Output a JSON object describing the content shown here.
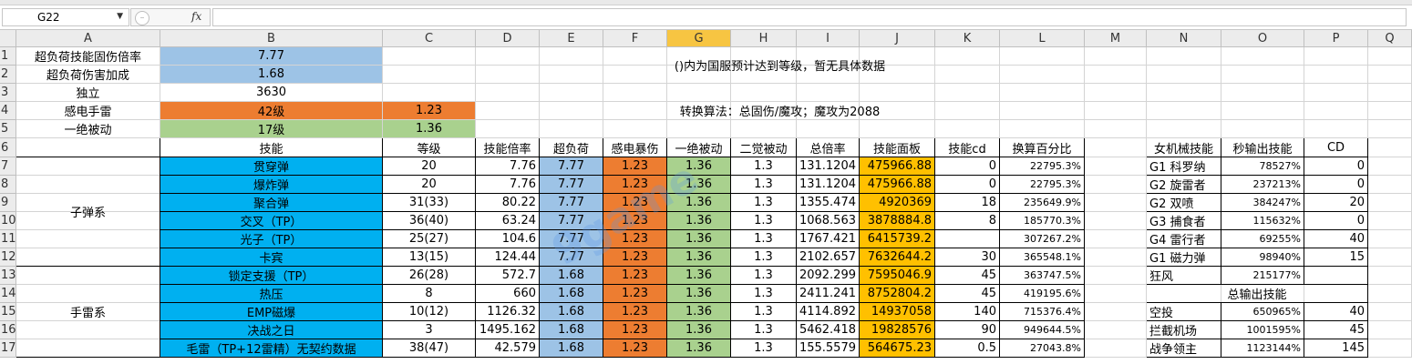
{
  "app": {
    "name_box": "G22",
    "formula_value": ""
  },
  "columns": [
    "A",
    "B",
    "C",
    "D",
    "E",
    "F",
    "G",
    "H",
    "I",
    "J",
    "K",
    "L",
    "M",
    "N",
    "O",
    "P",
    "Q"
  ],
  "selected_column": "G",
  "row_headers": [
    "1",
    "2",
    "3",
    "4",
    "5",
    "6",
    "7",
    "8",
    "9",
    "10",
    "11",
    "12",
    "13",
    "14",
    "15",
    "16",
    "17"
  ],
  "params": [
    {
      "label": "超负荷技能固伤倍率",
      "value": "7.77",
      "extra": ""
    },
    {
      "label": "超负荷伤害加成",
      "value": "1.68",
      "extra": ""
    },
    {
      "label": "独立",
      "value": "3630",
      "extra": ""
    },
    {
      "label": "感电手雷",
      "value": "42级",
      "extra": "1.23"
    },
    {
      "label": "一绝被动",
      "value": "17级",
      "extra": "1.36"
    }
  ],
  "notes": {
    "note1": "()内为国服预计达到等级，暂无具体数据",
    "note2": "转换算法：总固伤/魔攻；魔攻为2088"
  },
  "table": {
    "headers": [
      "技能",
      "等级",
      "技能倍率",
      "超负荷",
      "感电暴伤",
      "一绝被动",
      "二觉被动",
      "总倍率",
      "技能面板",
      "技能cd",
      "换算百分比"
    ],
    "groups": [
      {
        "name": "子弹系",
        "rows": 6
      },
      {
        "name": "手雷系",
        "rows": 5
      }
    ],
    "rows": [
      [
        "贯穿弹",
        "20",
        "7.76",
        "7.77",
        "1.23",
        "1.36",
        "1.3",
        "131.1204",
        "475966.88",
        "0",
        "22795.3%"
      ],
      [
        "爆炸弹",
        "20",
        "7.76",
        "7.77",
        "1.23",
        "1.36",
        "1.3",
        "131.1204",
        "475966.88",
        "0",
        "22795.3%"
      ],
      [
        "聚合弹",
        "31(33)",
        "80.22",
        "7.77",
        "1.23",
        "1.36",
        "1.3",
        "1355.474",
        "4920369",
        "18",
        "235649.9%"
      ],
      [
        "交叉（TP）",
        "36(40)",
        "63.24",
        "7.77",
        "1.23",
        "1.36",
        "1.3",
        "1068.563",
        "3878884.8",
        "8",
        "185770.3%"
      ],
      [
        "光子（TP）",
        "25(27)",
        "104.6",
        "7.77",
        "1.23",
        "1.36",
        "1.3",
        "1767.421",
        "6415739.2",
        "",
        "307267.2%"
      ],
      [
        "卡宾",
        "13(15)",
        "124.44",
        "7.77",
        "1.23",
        "1.36",
        "1.3",
        "2102.657",
        "7632644.2",
        "30",
        "365548.1%"
      ],
      [
        "锁定支援（TP）",
        "26(28)",
        "572.7",
        "1.68",
        "1.23",
        "1.36",
        "1.3",
        "2092.299",
        "7595046.9",
        "45",
        "363747.5%"
      ],
      [
        "热压",
        "8",
        "660",
        "1.68",
        "1.23",
        "1.36",
        "1.3",
        "2411.241",
        "8752804.2",
        "45",
        "419195.6%"
      ],
      [
        "EMP磁爆",
        "10(12)",
        "1126.32",
        "1.68",
        "1.23",
        "1.36",
        "1.3",
        "4114.892",
        "14937058",
        "140",
        "715376.4%"
      ],
      [
        "决战之日",
        "3",
        "1495.162",
        "1.68",
        "1.23",
        "1.36",
        "1.3",
        "5462.418",
        "19828576",
        "90",
        "949644.5%"
      ],
      [
        "毛雷（TP+12雷精）无契约数据",
        "38(47)",
        "42.579",
        "1.68",
        "1.23",
        "1.36",
        "1.3",
        "155.5579",
        "564675.23",
        "0.5",
        "27043.8%"
      ]
    ]
  },
  "side_table": {
    "headers": [
      "女机械技能",
      "秒输出技能",
      "CD"
    ],
    "rows": [
      [
        "G1 科罗纳",
        "78527%",
        "0"
      ],
      [
        "G2 旋雷者",
        "237213%",
        "0"
      ],
      [
        "G2 双喷",
        "384247%",
        "20"
      ],
      [
        "G3 捕食者",
        "115632%",
        "0"
      ],
      [
        "G4 雷行者",
        "69255%",
        "40"
      ],
      [
        "G1 磁力弹",
        "98940%",
        "15"
      ],
      [
        "狂风",
        "215177%",
        ""
      ]
    ],
    "section2_title": "总输出技能",
    "rows2": [
      [
        "空投",
        "650965%",
        "40"
      ],
      [
        "拦截机场",
        "1001595%",
        "45"
      ],
      [
        "战争领主",
        "1123144%",
        "145"
      ]
    ]
  },
  "watermark_text": "9game",
  "colors": {
    "blue": "#9dc3e6",
    "orange": "#ed7d31",
    "green": "#a9d18e",
    "cyan": "#00b0f0",
    "gold": "#ffc000",
    "header_selected": "#f7c542"
  }
}
